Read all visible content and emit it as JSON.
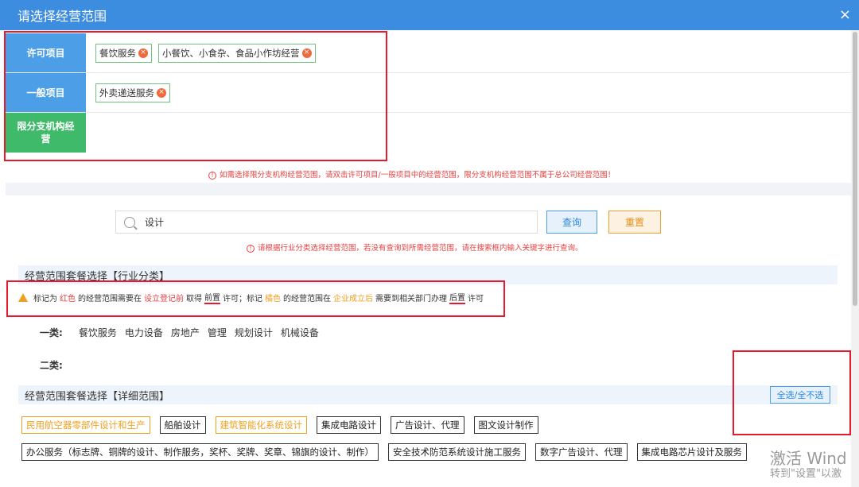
{
  "dialog": {
    "title": "请选择经营范围",
    "close_glyph": "×"
  },
  "scope": {
    "rows": [
      {
        "head": "许可项目",
        "tags": [
          "餐饮服务",
          "小餐饮、小食杂、食品小作坊经营"
        ]
      },
      {
        "head": "一般项目",
        "tags": [
          "外卖递送服务"
        ]
      },
      {
        "head": "限分支机构经营",
        "tags": []
      }
    ],
    "remove_glyph": "×"
  },
  "branch_note": "如需选择限分支机构经营范围，请双击许可项目/一般项目中的经营范围，限分支机构经营范围不属于总公司经营范围！",
  "search": {
    "value": "设计",
    "query_label": "查询",
    "reset_label": "重置"
  },
  "search_note": "请根据行业分类选择经营范围，若没有查询到所需经营范围，请在搜索框内输入关键字进行查询。",
  "industry_section": {
    "title": "经营范围套餐选择【行业分类】"
  },
  "warning": {
    "p1": "标记为",
    "red_word": "红色",
    "p2": "的经营范围需要在",
    "p3": "设立登记前",
    "p4": "取得",
    "p5": "前置",
    "p6": "许可；标记",
    "orange_word": "橘色",
    "p7": "的经营范围在",
    "p8": "企业成立后",
    "p9": "需要到相关部门办理",
    "p10": "后置",
    "p11": "许可"
  },
  "categories": {
    "class1_label": "一类:",
    "class1_items": [
      "餐饮服务",
      "电力设备",
      "房地产",
      "管理",
      "规划设计",
      "机械设备"
    ],
    "class2_label": "二类:"
  },
  "detail_section": {
    "title": "经营范围套餐选择【详细范围】",
    "toggle_label": "全选/全不选"
  },
  "chips_row1": [
    {
      "label": "民用航空器零部件设计和生产",
      "color": "orange"
    },
    {
      "label": "船舶设计",
      "color": "black"
    },
    {
      "label": "建筑智能化系统设计",
      "color": "orange"
    },
    {
      "label": "集成电路设计",
      "color": "black"
    },
    {
      "label": "广告设计、代理",
      "color": "black"
    },
    {
      "label": "图文设计制作",
      "color": "black"
    }
  ],
  "chips_row2": [
    {
      "label": "办公服务（标志牌、铜牌的设计、制作服务，奖杯、奖牌、奖章、锦旗的设计、制作）",
      "color": "black"
    },
    {
      "label": "安全技术防范系统设计施工服务",
      "color": "black"
    },
    {
      "label": "数字广告设计、代理",
      "color": "black"
    },
    {
      "label": "集成电路芯片设计及服务",
      "color": "black"
    }
  ],
  "watermark": {
    "line1": "激活 Wind",
    "line2": "转到\"设置\"以激"
  },
  "colors": {
    "title_bar": "#3c8de0",
    "red": "#e8192c",
    "orange": "#f0a020",
    "green_head": "#3fba6a",
    "blue_head": "#4c9fe6"
  }
}
